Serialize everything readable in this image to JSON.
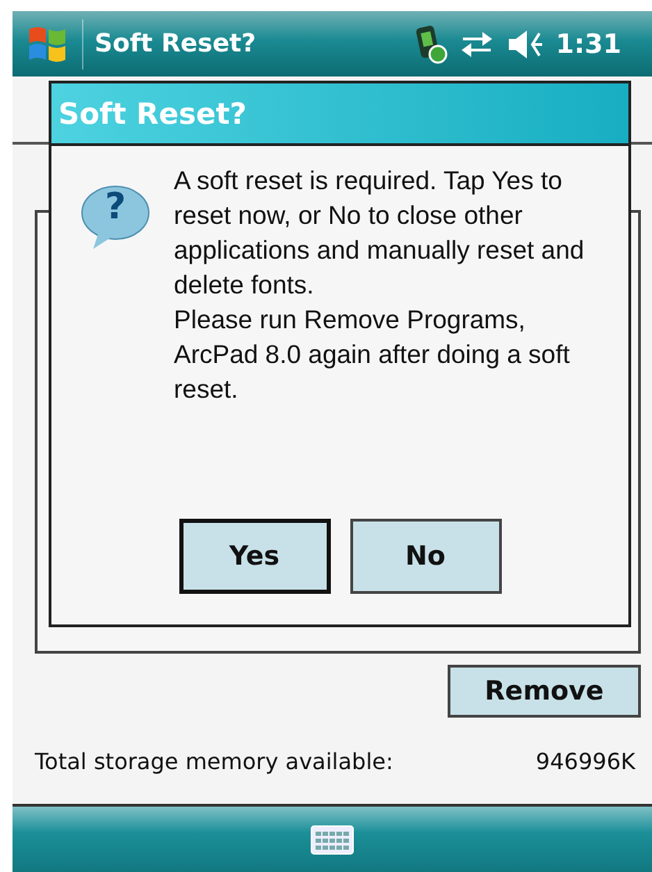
{
  "top_bar": {
    "title": "Soft Reset?",
    "time": "1:31"
  },
  "dialog": {
    "title": "Soft Reset?",
    "icon_glyph": "?",
    "message": "A soft reset is required. Tap Yes to reset now, or No to close other applications and manually reset and delete fonts.\nPlease run Remove Programs, ArcPad 8.0 again after doing a soft reset.",
    "buttons": [
      {
        "label": "Yes",
        "selected": true
      },
      {
        "label": "No",
        "selected": false
      }
    ]
  },
  "remove_button": "Remove",
  "storage": {
    "label": "Total storage memory available:",
    "value": "946996K"
  }
}
